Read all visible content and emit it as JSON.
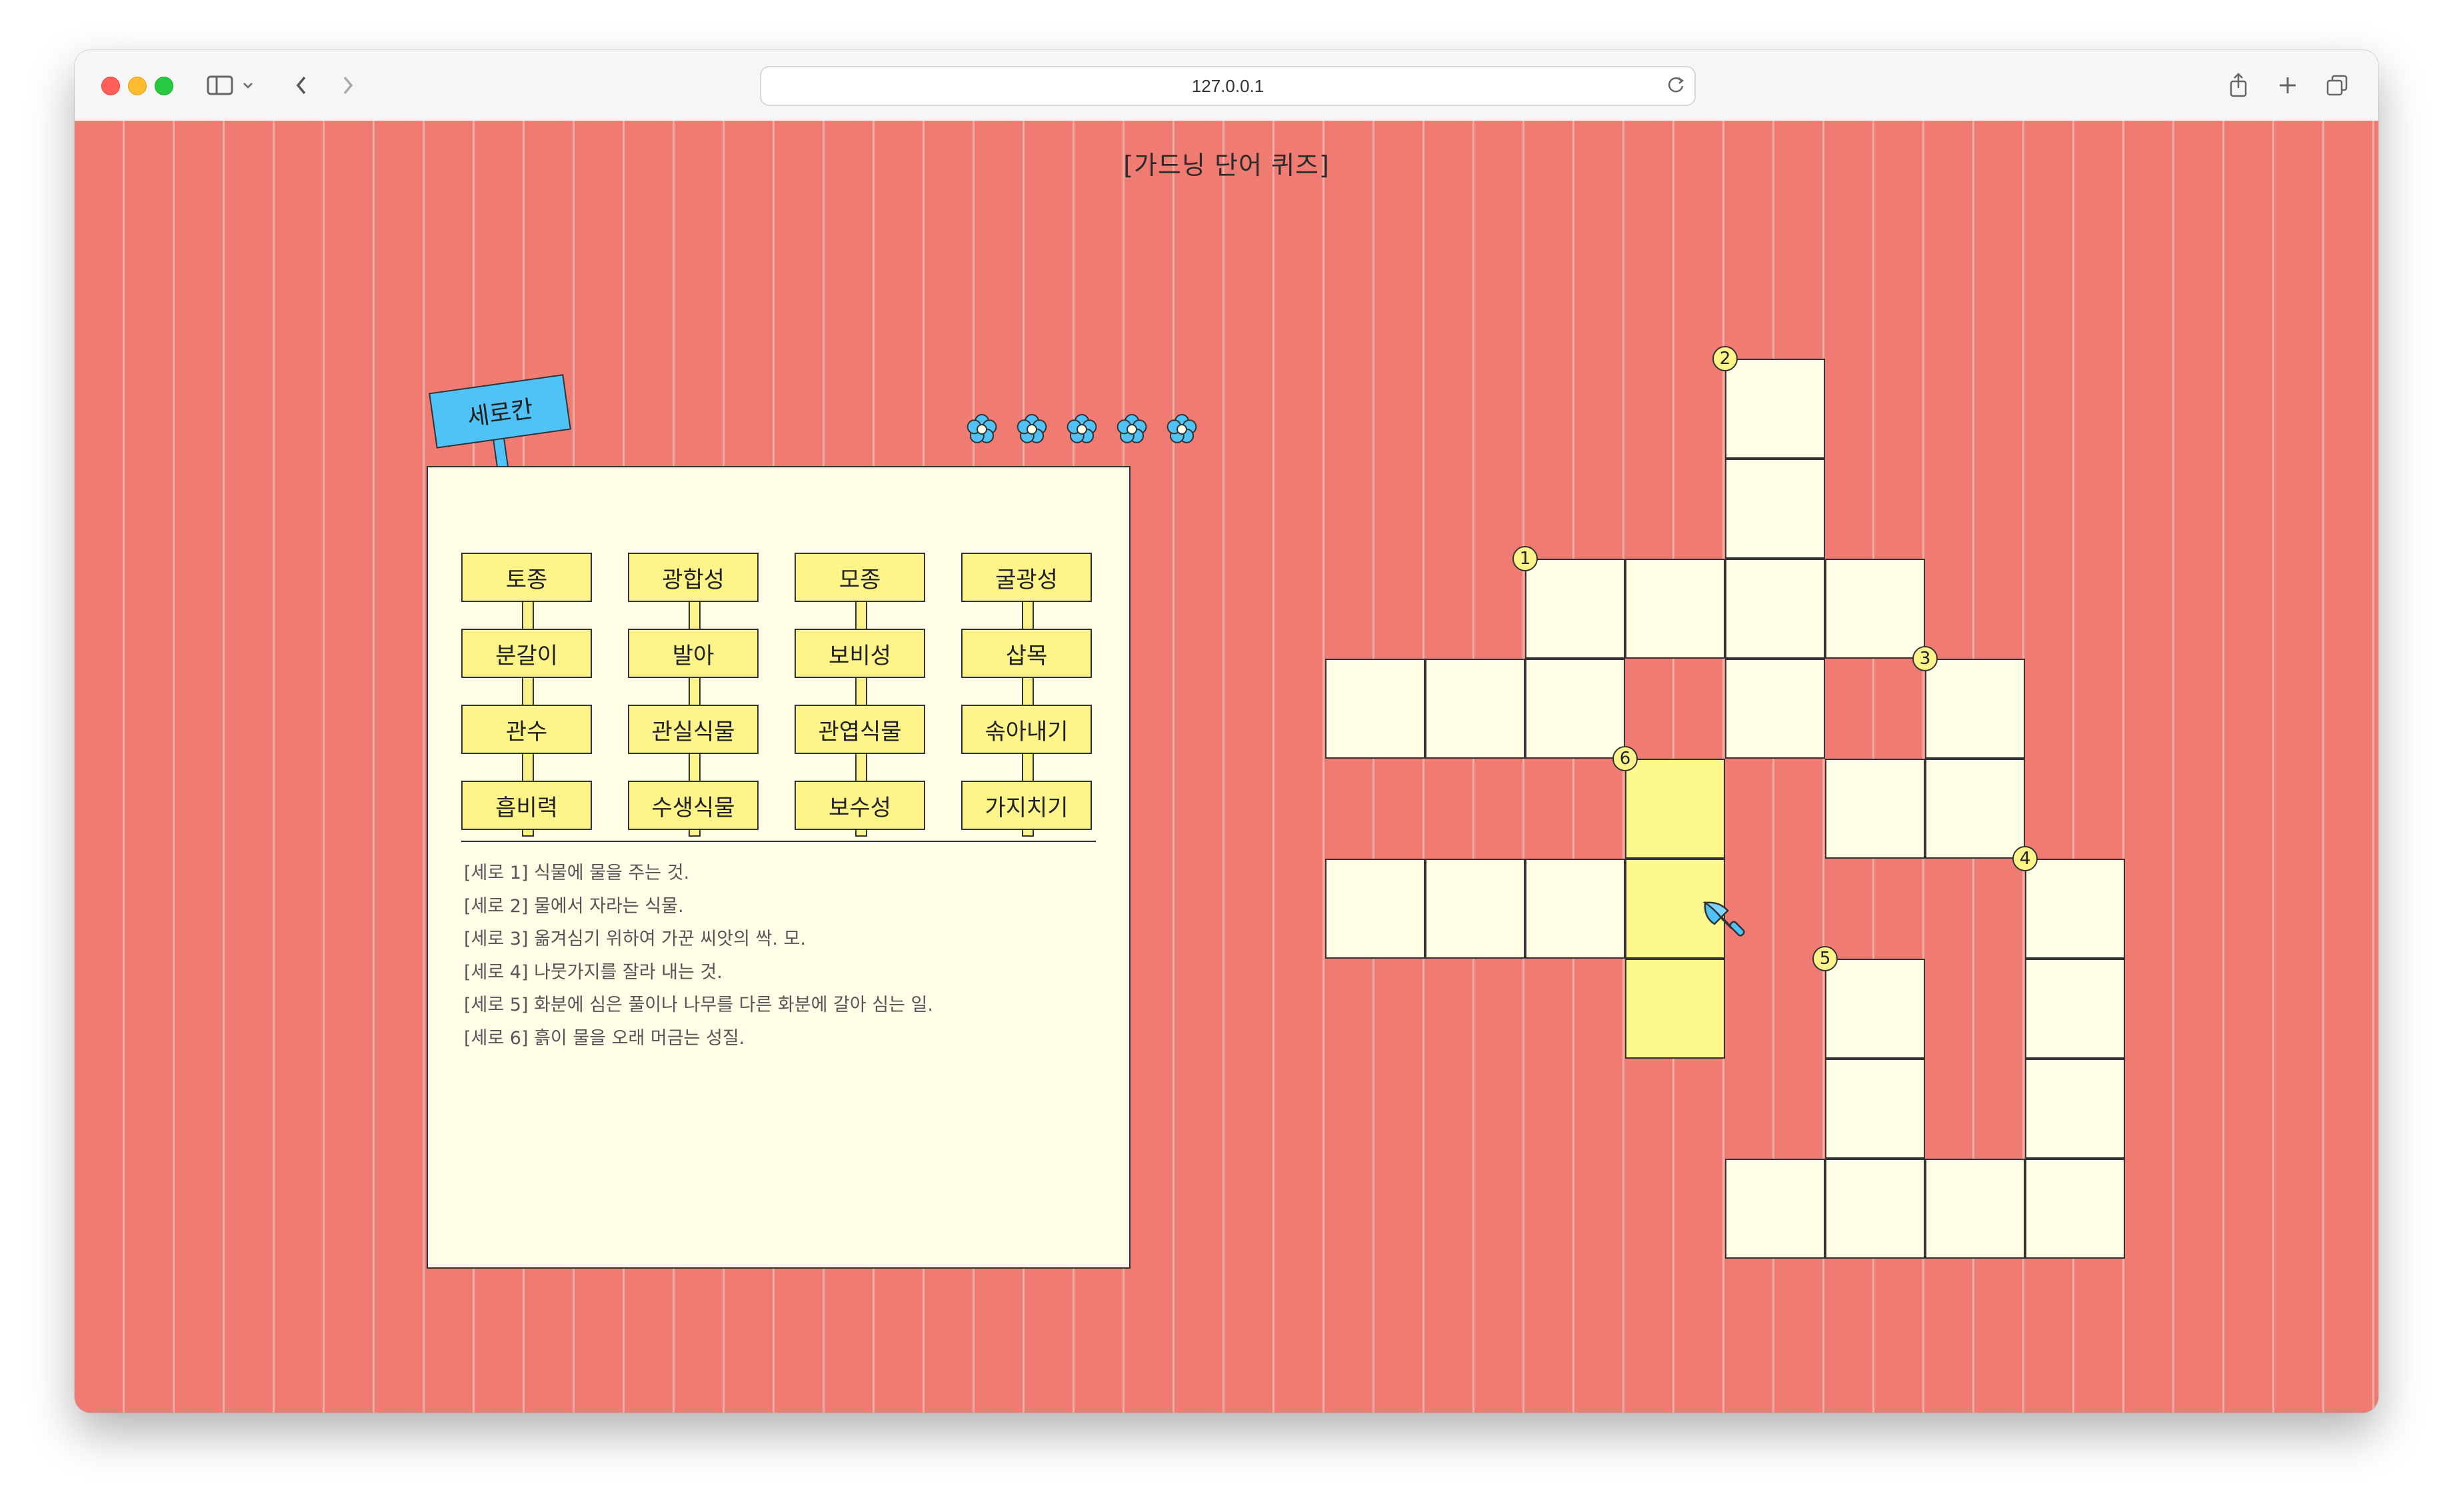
{
  "browser": {
    "url": "127.0.0.1"
  },
  "quiz": {
    "title": "[가드닝 단어 퀴즈]",
    "direction_label": "세로칸",
    "words": [
      [
        "토종",
        "광합성",
        "모종",
        "굴광성"
      ],
      [
        "분갈이",
        "발아",
        "보비성",
        "삽목"
      ],
      [
        "관수",
        "관실식물",
        "관엽식물",
        "솎아내기"
      ],
      [
        "흡비력",
        "수생식물",
        "보수성",
        "가지치기"
      ]
    ],
    "clues": [
      "[세로 1] 식물에 물을 주는 것.",
      "[세로 2] 물에서 자라는 식물.",
      "[세로 3] 옮겨심기 위하여 가꾼 씨앗의 싹. 모.",
      "[세로 4] 나뭇가지를 잘라 내는 것.",
      "[세로 5] 화분에 심은 풀이나 나무를 다른 화분에 갈아 심는 일.",
      "[세로 6] 흙이 물을 오래 머금는 성질."
    ],
    "clue_numbers": [
      "1",
      "2",
      "3",
      "4",
      "5",
      "6"
    ]
  },
  "colors": {
    "background": "#ef7b72",
    "panel": "#fffde6",
    "word_sign": "#fdf48a",
    "label_sign": "#4fc3f7",
    "highlight": "#fdf98e"
  },
  "icons": {
    "flowers": [
      "flower-icon",
      "flower-icon",
      "flower-icon",
      "flower-icon",
      "flower-icon"
    ],
    "cursor": "trowel-cursor-icon"
  }
}
